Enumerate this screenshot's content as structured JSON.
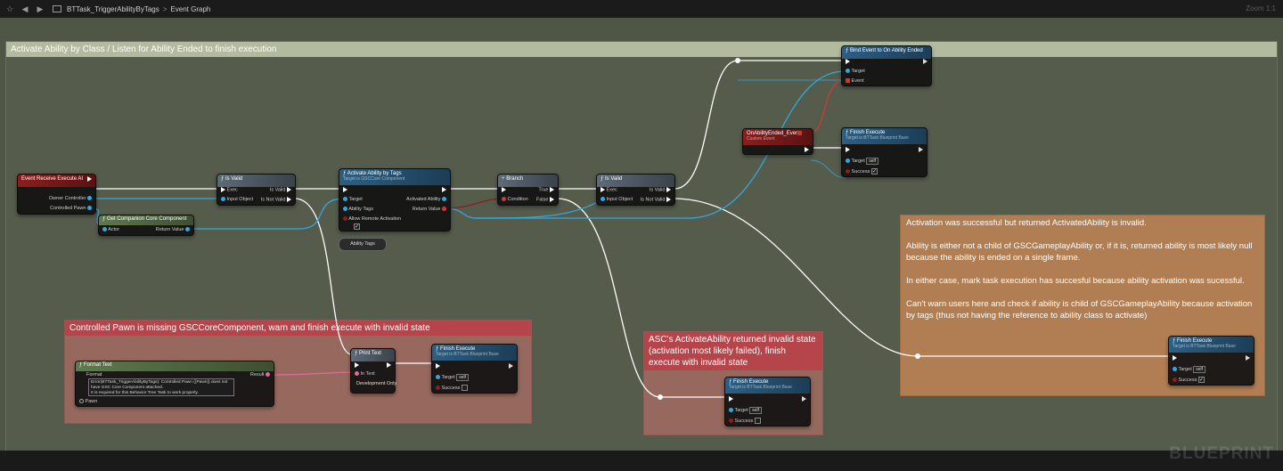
{
  "toolbar": {
    "breadcrumb_asset": "BTTask_TriggerAbilityByTags",
    "breadcrumb_separator": ">",
    "breadcrumb_graph": "Event Graph",
    "zoom": "Zoom 1:1"
  },
  "watermark": "BLUEPRINT",
  "comments": {
    "main": "Activate Ability by Class / Listen for Ability Ended to finish execution",
    "missing_component": "Controlled Pawn is missing GSCCoreComponent, warn and finish execute with invalid state",
    "invalid_state": "ASC's ActivateAbility returned invalid state (activation most likely failed), finish execute with invalid state",
    "success_note": "Activation was successful but returned ActivatedAbility is invalid.\n\nAbility is either not a child of GSCGameplayAbility or, if it is, returned ability is most likely null because the ability is ended on a single frame.\n\nIn either case, mark task execution has succesful because ability activation was sucessful.\n\nCan't warn users here and check if ability is child of GSCGameplayAbility because activation by tags (thus not having the reference to ability class to activate)"
  },
  "nodes": {
    "event_receive": {
      "title": "Event Receive Execute AI",
      "pin_owner": "Owner Controller",
      "pin_pawn": "Controlled Pawn"
    },
    "is_valid_1": {
      "title": "Is Valid",
      "pin_exec": "Exec",
      "pin_input": "Input Object",
      "pin_valid": "Is Valid",
      "pin_not_valid": "Is Not Valid"
    },
    "get_component": {
      "title": "Get Companion Core Component",
      "pin_actor": "Actor",
      "pin_return": "Return Value"
    },
    "activate_ability": {
      "title": "Activate Ability by Tags",
      "subtitle": "Target is GSCCore Component",
      "pin_target": "Target",
      "pin_tags": "Ability Tags",
      "pin_remote": "Allow Remote Activation",
      "pin_activated": "Activated Ability",
      "pin_return": "Return Value"
    },
    "ability_tags_var": {
      "label": "Ability Tags"
    },
    "branch": {
      "title": "Branch",
      "pin_condition": "Condition",
      "pin_true": "True",
      "pin_false": "False"
    },
    "is_valid_2": {
      "title": "Is Valid",
      "pin_exec": "Exec",
      "pin_input": "Input Object",
      "pin_valid": "Is Valid",
      "pin_not_valid": "Is Not Valid"
    },
    "bind_event": {
      "title": "Bind Event to On Ability Ended",
      "pin_target": "Target",
      "pin_event": "Event"
    },
    "on_ability_ended": {
      "title": "OnAbilityEnded_Event",
      "subtitle": "Custom Event"
    },
    "finish_top": {
      "title": "Finish Execute",
      "subtitle": "Target is BTTask Blueprint Base",
      "pin_target": "Target",
      "target_value": "self",
      "pin_success": "Success",
      "success_checked": "✓"
    },
    "format_text": {
      "title": "Format Text",
      "pin_format": "Format",
      "format_value": "Error(BTTask_TriggerAbilityByTags): Controlled Pawn ({Pawn}) does not have GSC Core Component attached.\nIt is required for this Behavior Tree Task to work properly.",
      "pin_pawn": "Pawn",
      "pin_result": "Result"
    },
    "print_text": {
      "title": "Print Text",
      "pin_text": "In Text",
      "dev_only": "Development Only"
    },
    "finish_missing": {
      "title": "Finish Execute",
      "subtitle": "Target is BTTask Blueprint Base",
      "pin_target": "Target",
      "target_value": "self",
      "pin_success": "Success",
      "success_checked": ""
    },
    "finish_invalid": {
      "title": "Finish Execute",
      "subtitle": "Target is BTTask Blueprint Base",
      "pin_target": "Target",
      "target_value": "self",
      "pin_success": "Success",
      "success_checked": ""
    },
    "finish_success": {
      "title": "Finish Execute",
      "subtitle": "Target is BTTask Blueprint Base",
      "pin_target": "Target",
      "target_value": "self",
      "pin_success": "Success",
      "success_checked": "✓"
    }
  },
  "colors": {
    "exec_wire": "#ffffff",
    "object_wire": "#30a8e0",
    "bool_wire": "#8b1d1d",
    "delegate_wire": "#d23838"
  }
}
